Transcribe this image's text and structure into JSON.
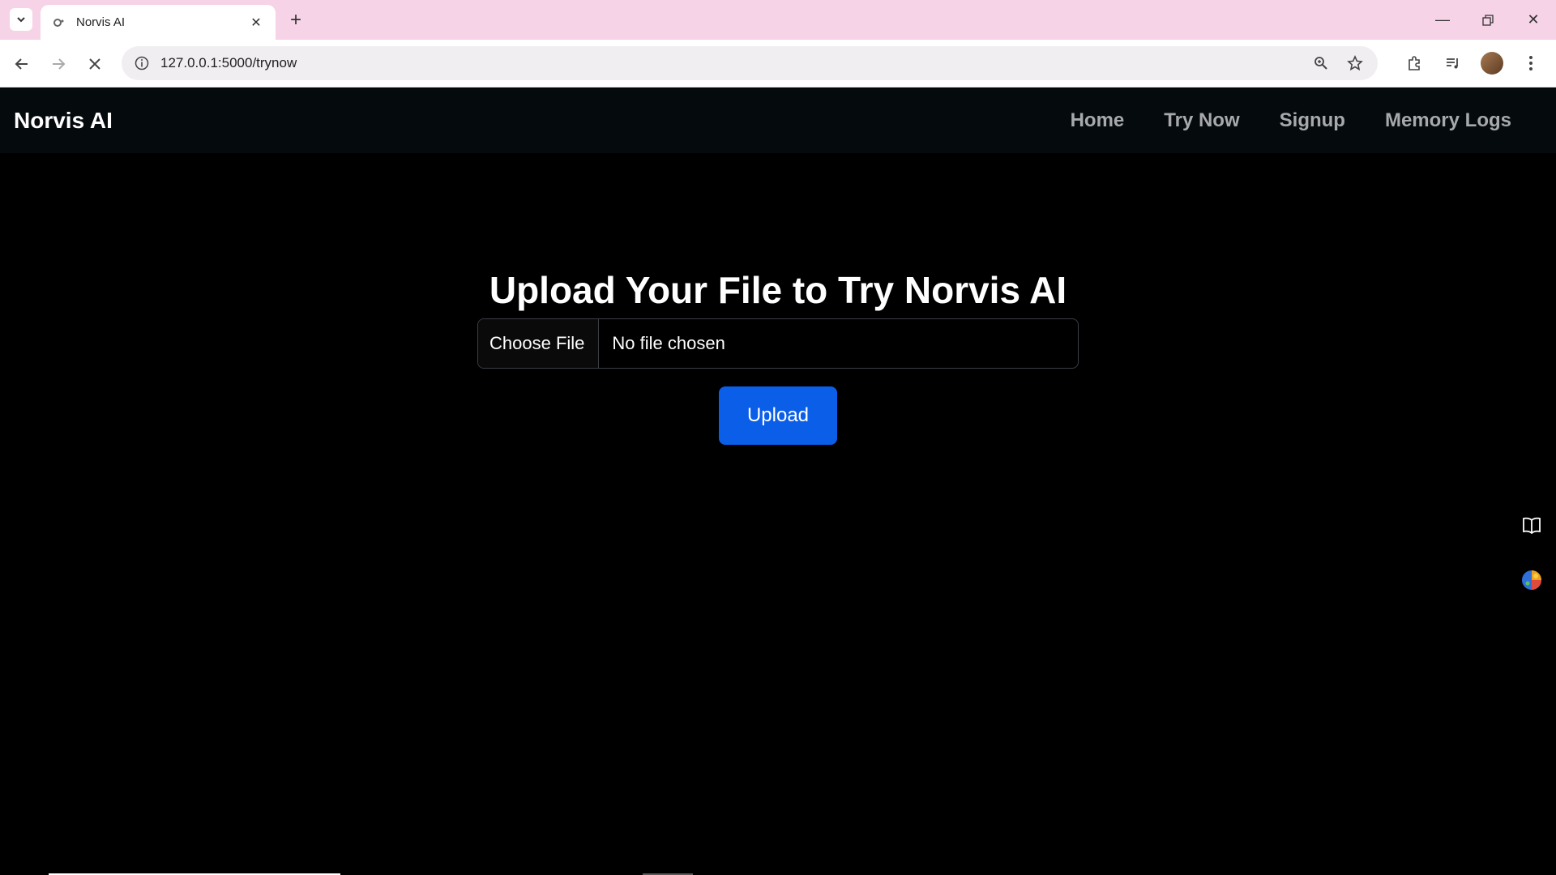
{
  "browser": {
    "tab_title": "Norvis AI",
    "new_tab_label": "+",
    "url": "127.0.0.1:5000/trynow",
    "colors": {
      "tabbar": "#f6d3e6",
      "toolbar": "#ffffff"
    }
  },
  "navbar": {
    "brand": "Norvis AI",
    "links": [
      {
        "label": "Home"
      },
      {
        "label": "Try Now"
      },
      {
        "label": "Signup"
      },
      {
        "label": "Memory Logs"
      }
    ]
  },
  "main": {
    "heading": "Upload Your File to Try Norvis AI",
    "file_input": {
      "button_label": "Choose File",
      "status": "No file chosen"
    },
    "upload_button": "Upload",
    "colors": {
      "upload_button": "#0b5ee8",
      "background": "#000000"
    }
  },
  "icons": [
    "tab-search-icon",
    "favicon-icon",
    "close-icon",
    "back-icon",
    "forward-icon",
    "stop-loading-icon",
    "info-icon",
    "zoom-icon",
    "bookmark-star-icon",
    "extensions-icon",
    "media-control-icon",
    "profile-avatar",
    "menu-kebab-icon",
    "reading-mode-icon",
    "color-globe-icon"
  ]
}
